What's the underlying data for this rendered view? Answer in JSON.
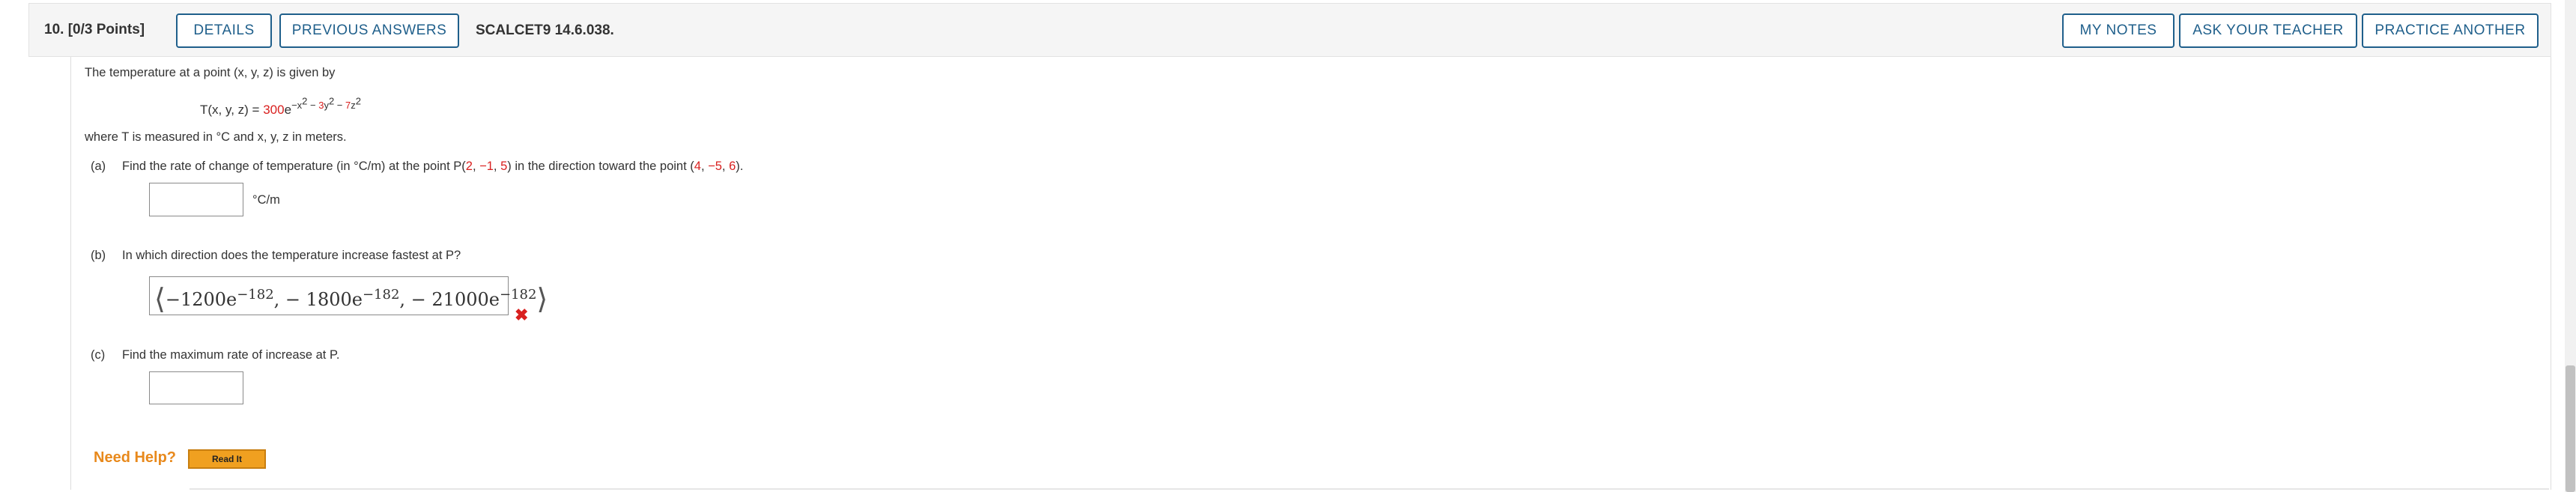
{
  "header": {
    "question_number": "10.",
    "points": "[0/3 Points]",
    "details_label": "DETAILS",
    "previous_answers_label": "PREVIOUS ANSWERS",
    "problem_code": "SCALCET9 14.6.038.",
    "my_notes_label": "MY NOTES",
    "ask_teacher_label": "ASK YOUR TEACHER",
    "practice_another_label": "PRACTICE ANOTHER"
  },
  "problem": {
    "intro": "The temperature at a point (x, y, z) is given by",
    "formula_lhs": "T(x, y, z) = ",
    "formula_coef": "300",
    "formula_base": "e",
    "formula_exp_1": "−x",
    "formula_exp_2": "2",
    "formula_exp_3": " − ",
    "formula_exp_4": "3",
    "formula_exp_5": "y",
    "formula_exp_6": "2",
    "formula_exp_7": " − ",
    "formula_exp_8": "7",
    "formula_exp_9": "z",
    "formula_exp_10": "2",
    "units_note": "where T is measured in °C and x, y, z in meters."
  },
  "part_a": {
    "label": "(a)",
    "text_1": "Find the rate of change of temperature (in °C/m) at the point P(",
    "p_x": "2",
    "p_sep1": ", ",
    "p_y": "−1",
    "p_sep2": ", ",
    "p_z": "5",
    "text_2": ") in the direction toward the point (",
    "q_x": "4",
    "q_sep1": ", ",
    "q_y": "−5",
    "q_sep2": ", ",
    "q_z": "6",
    "text_3": ").",
    "answer_value": "",
    "unit": "°C/m"
  },
  "part_b": {
    "label": "(b)",
    "question": "In which direction does the temperature increase fastest at P?",
    "answer_open": "⟨",
    "c1_coef": "−1200e",
    "c1_exp": "−182",
    "sep1": ",  − 1800e",
    "c2_exp": "−182",
    "sep2": ",  − 21000e",
    "c3_exp": "−182",
    "answer_close": "⟩",
    "status": "incorrect"
  },
  "part_c": {
    "label": "(c)",
    "question": "Find the maximum rate of increase at P.",
    "answer_value": ""
  },
  "help": {
    "need_help_label": "Need Help?",
    "read_it_label": "Read It"
  },
  "colors": {
    "accent": "#1f5f8b",
    "highlight_red": "#d9201f",
    "help_orange": "#e8891c"
  }
}
